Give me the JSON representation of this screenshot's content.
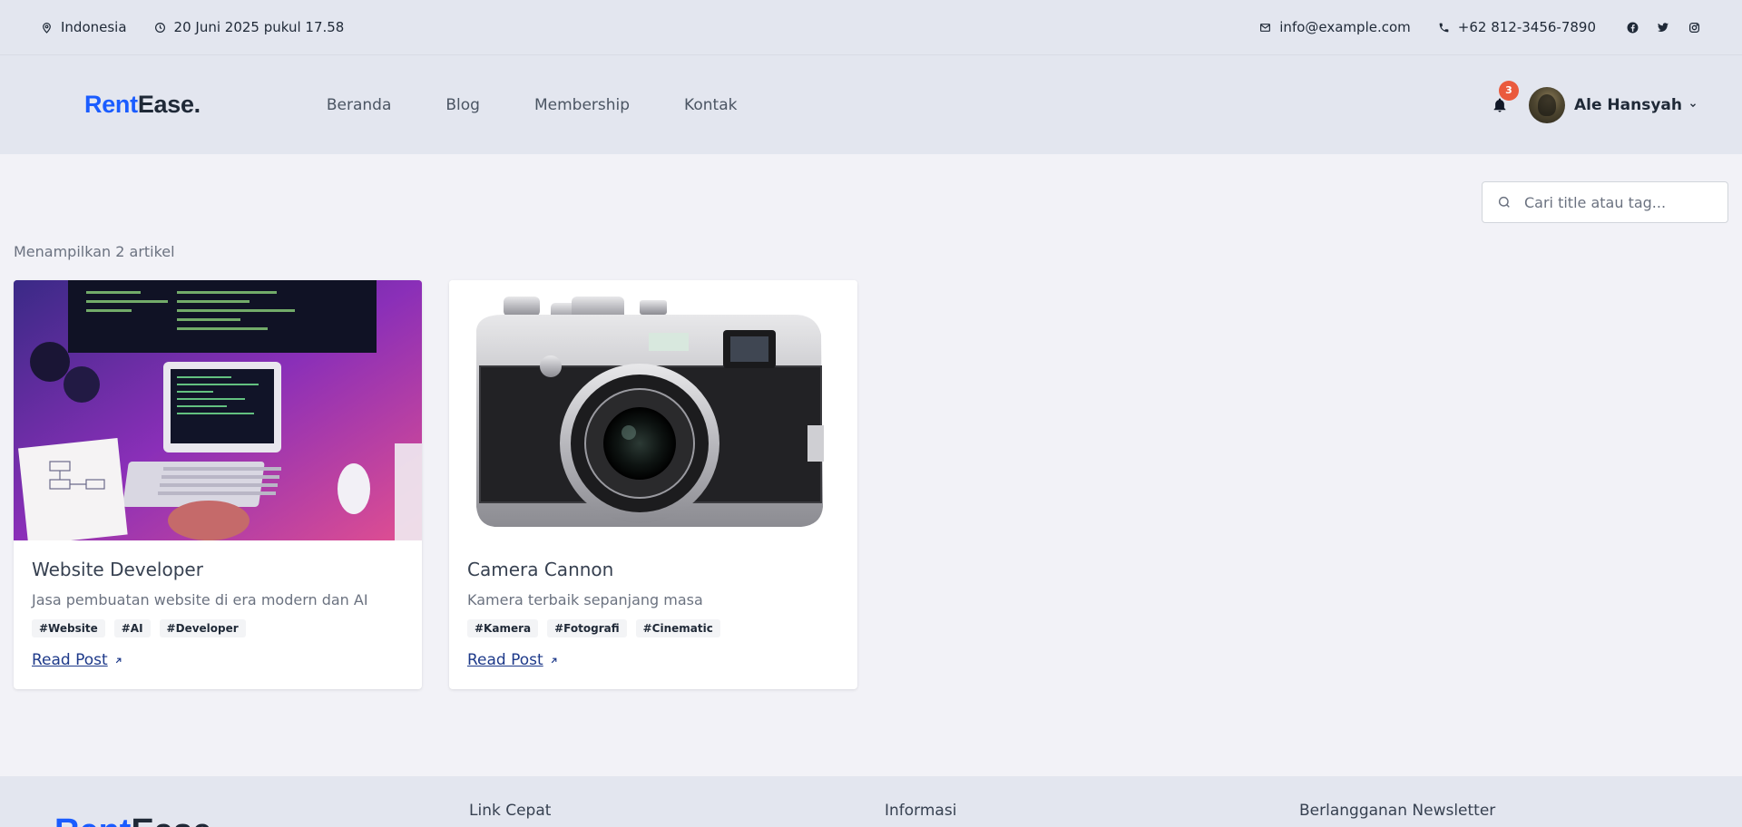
{
  "topbar": {
    "location": "Indonesia",
    "datetime": "20 Juni 2025 pukul 17.58",
    "email": "info@example.com",
    "phone": "+62 812-3456-7890",
    "icons": [
      "map-pin-icon",
      "clock-icon",
      "mail-icon",
      "phone-icon",
      "facebook-icon",
      "twitter-icon",
      "instagram-icon"
    ]
  },
  "navbar": {
    "brand_accent": "Rent",
    "brand_rest": "Ease.",
    "links": [
      "Beranda",
      "Blog",
      "Membership",
      "Kontak"
    ],
    "notification_count": "3",
    "user_name": "Ale Hansyah"
  },
  "search": {
    "placeholder": "Cari title atau tag..."
  },
  "results_count": "Menampilkan 2 artikel",
  "articles": [
    {
      "title": "Website Developer",
      "description": "Jasa pembuatan website di era modern dan AI",
      "tags": [
        "#Website",
        "#AI",
        "#Developer"
      ],
      "read_label": "Read Post"
    },
    {
      "title": "Camera Cannon",
      "description": "Kamera terbaik sepanjang masa",
      "tags": [
        "#Kamera",
        "#Fotografi",
        "#Cinematic"
      ],
      "read_label": "Read Post"
    }
  ],
  "footer": {
    "brand_accent": "Rent",
    "brand_rest": "Ease",
    "headings": [
      "Link Cepat",
      "Informasi",
      "Berlangganan Newsletter"
    ]
  },
  "colors": {
    "accent": "#1a5cff",
    "badge": "#ea5a3d",
    "header_bg": "#e3e6ef",
    "page_bg": "#f2f2f7"
  }
}
